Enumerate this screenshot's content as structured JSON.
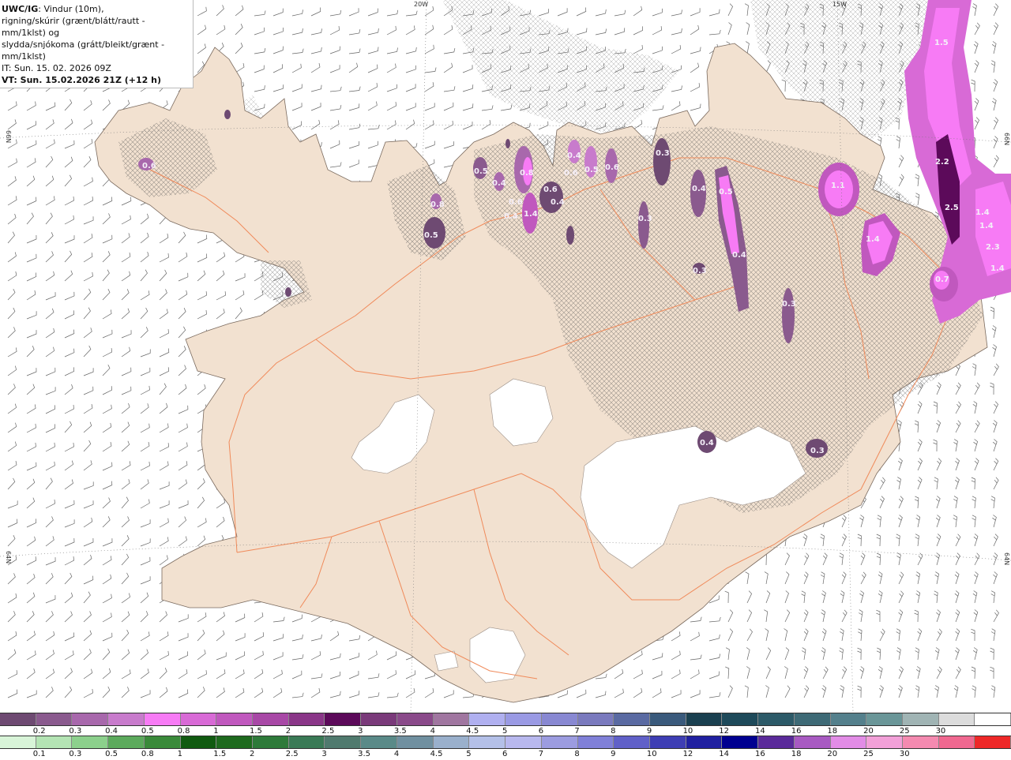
{
  "title": {
    "line1_bold": "UWC/IG",
    "line1_rest": ": Vindur (10m),",
    "line2": "rigning/skúrir (grænt/blátt/rautt - mm/1klst) og",
    "line3": "slydda/snjókoma (grátt/bleikt/grænt - mm/1klst)",
    "line4": "IT: Sun. 15. 02. 2026 09Z",
    "line5": "VT: Sun. 15.02.2026 21Z (+12 h)"
  },
  "grid_labels": {
    "lon_20w": "20W",
    "lon_15w": "15W",
    "lat_66n_left": "66N",
    "lat_66n_right": "66N",
    "lat_64n_left": "64N",
    "lat_64n_right": "64N"
  },
  "precip_labels": [
    "0.6",
    "0.8",
    "0.5",
    "0.5",
    "0.4",
    "0.6",
    "0.8",
    "0.4",
    "0.6",
    "0.4",
    "1.4",
    "0.4",
    "0.6",
    "0.5",
    "0.6",
    "0.3",
    "0.4",
    "0.5",
    "0.3",
    "0.4",
    "0.3",
    "0.3",
    "1.1",
    "1.4",
    "0.7",
    "1.5",
    "2.2",
    "2.5",
    "1.4",
    "1.4",
    "2.3",
    "1.4",
    "0.4",
    "0.3"
  ],
  "legend_snow": {
    "colors": [
      "#6e4a72",
      "#8a5a8e",
      "#a868ac",
      "#c87bcc",
      "#f77bf5",
      "#d86ad6",
      "#c058be",
      "#a848a6",
      "#8a3688",
      "#5c0a5a",
      "#7a3a7a",
      "#8a4a8a",
      "#a076a0",
      "#b0b0f0",
      "#9a9ae4",
      "#8888d2",
      "#7a7abe",
      "#5a6aa2",
      "#3a5a7c",
      "#1a4050",
      "#1e4a5a",
      "#2c5a68",
      "#3e6a76",
      "#54808c",
      "#6a9698",
      "#a0b4b4",
      "#dcdcdc",
      "#ffffff"
    ],
    "labels": [
      "0.2",
      "0.3",
      "0.4",
      "0.5",
      "0.8",
      "1",
      "1.5",
      "2",
      "2.5",
      "3",
      "3.5",
      "4",
      "4.5",
      "5",
      "6",
      "7",
      "8",
      "9",
      "10",
      "12",
      "14",
      "16",
      "18",
      "20",
      "25",
      "30"
    ]
  },
  "legend_rain": {
    "colors": [
      "#d8f4d8",
      "#b4e4b4",
      "#8cd08c",
      "#5caa5c",
      "#3a8a3a",
      "#105a10",
      "#1e6a1e",
      "#2e7a3a",
      "#3a7a56",
      "#507a6e",
      "#5a8a88",
      "#7090a0",
      "#9ab0cc",
      "#b4c0e8",
      "#b8b8ee",
      "#9c9ce0",
      "#8080d8",
      "#6060c8",
      "#3e3eb4",
      "#2020a0",
      "#000090",
      "#5a2a9a",
      "#a85ac2",
      "#e28ce6",
      "#f2a0d8",
      "#f48ab0",
      "#f06890",
      "#ee2828"
    ],
    "labels": [
      "0.1",
      "0.3",
      "0.5",
      "0.8",
      "1",
      "1.5",
      "2",
      "2.5",
      "3",
      "3.5",
      "4",
      "4.5",
      "5",
      "6",
      "7",
      "8",
      "9",
      "10",
      "12",
      "14",
      "16",
      "18",
      "20",
      "25",
      "30"
    ]
  }
}
